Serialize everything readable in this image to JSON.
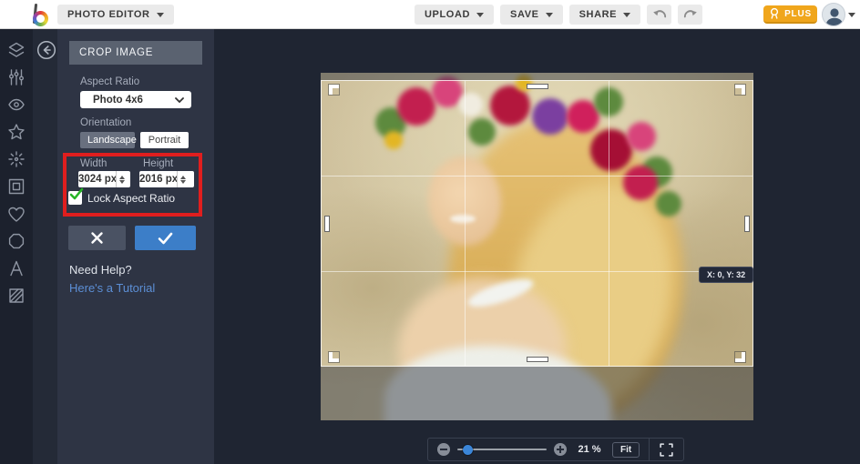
{
  "topbar": {
    "app_menu_label": "PHOTO EDITOR",
    "upload_label": "UPLOAD",
    "save_label": "SAVE",
    "share_label": "SHARE",
    "plus_label": "PLUS",
    "icons": [
      "befunky-logo",
      "undo-icon",
      "redo-icon",
      "medal-icon",
      "avatar",
      "caret-down-icon"
    ]
  },
  "sidebar": {
    "icons": [
      "stacked-layers-icon",
      "sliders-icon",
      "eye-icon",
      "star-icon",
      "sparkle-burst-icon",
      "frame-icon",
      "heart-icon",
      "seal-badge-icon",
      "letter-a-icon",
      "hatched-square-icon",
      "back-arrow-icon"
    ]
  },
  "panel": {
    "title": "CROP IMAGE",
    "aspect_ratio_label": "Aspect Ratio",
    "aspect_ratio_value": "Photo 4x6",
    "orientation_label": "Orientation",
    "landscape_label": "Landscape",
    "portrait_label": "Portrait",
    "width_label": "Width",
    "height_label": "Height",
    "width_value": "3024 px",
    "height_value": "2016 px",
    "lock_label": "Lock Aspect Ratio",
    "lock_checked": true,
    "help_text": "Need Help?",
    "tutorial_link": "Here's a Tutorial"
  },
  "canvas": {
    "tooltip": "X: 0, Y: 32"
  },
  "zoombar": {
    "zoom_value": "21 %",
    "zoom_percent": 21,
    "fit_label": "Fit"
  },
  "colors": {
    "highlight_red": "#E01E1E",
    "apply_blue": "#3C7EC8",
    "link_blue": "#5C8FD6",
    "plus_orange": "#F0A61C",
    "check_green": "#28B428",
    "selected_slate": "#69707F"
  }
}
